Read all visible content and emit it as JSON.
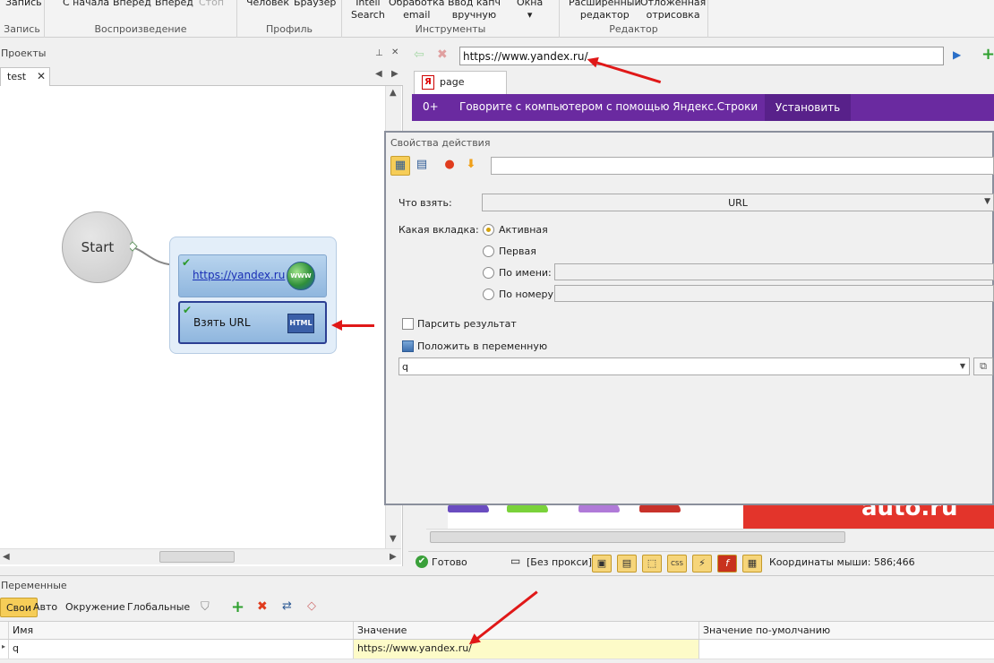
{
  "ribbon": {
    "groups": [
      {
        "title": "Запись",
        "buttons": [
          "Запись"
        ]
      },
      {
        "title": "Воспроизведение",
        "buttons": [
          "С начала",
          "Вперед",
          "Вперед",
          "Стоп"
        ]
      },
      {
        "title": "Профиль",
        "buttons": [
          "Человек",
          "Браузер"
        ]
      },
      {
        "title": "Инструменты",
        "buttons": [
          "Intell\nSearch",
          "Обработка\nemail",
          "Ввод капч\nвручную",
          "Окна\n▾"
        ]
      },
      {
        "title": "Редактор",
        "buttons": [
          "Расширенный\nредактор",
          "Отложенная\nотрисовка"
        ]
      }
    ]
  },
  "projects": {
    "header": "Проекты",
    "tab": "test",
    "start_label": "Start",
    "actions": [
      {
        "label": "https://yandex.ru",
        "icon": "www-globe-icon",
        "icon_text": "WWW"
      },
      {
        "label": "Взять URL",
        "icon": "html-icon",
        "icon_text": "HTML"
      }
    ]
  },
  "browser": {
    "url": "https://www.yandex.ru/",
    "tab": "page",
    "promo_age": "0+",
    "promo_text": "Говорите с компьютером с помощью Яндекс.Строки",
    "promo_button": "Установить",
    "banner_text": "auto.ru",
    "status_ready": "Готово",
    "status_proxy": "[Без прокси]",
    "mouse_coords": "Координаты мыши: 586;466"
  },
  "properties": {
    "title": "Свойства действия",
    "what_label": "Что взять:",
    "what_value": "URL",
    "tab_label": "Какая вкладка:",
    "radios": [
      "Активная",
      "Первая",
      "По имени:",
      "По номеру:"
    ],
    "parse_label": "Парсить результат",
    "var_label": "Положить в переменную",
    "var_value": "q"
  },
  "variables": {
    "header": "Переменные",
    "tabs": [
      "Свои",
      "Авто",
      "Окружение",
      "Глобальные"
    ],
    "columns": [
      "Имя",
      "Значение",
      "Значение по-умолчанию"
    ],
    "rows": [
      {
        "name": "q",
        "value": "https://www.yandex.ru/",
        "default": ""
      }
    ]
  }
}
